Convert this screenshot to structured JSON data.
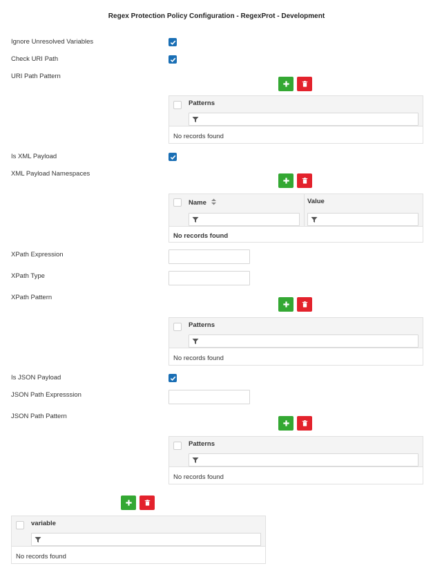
{
  "title": "Regex Protection Policy Configuration - RegexProt - Development",
  "fields": {
    "ignore_unresolved": "Ignore Unresolved Variables",
    "check_uri_path": "Check URI Path",
    "uri_path_pattern": "URI Path Pattern",
    "is_xml_payload": "Is XML Payload",
    "xml_payload_namespaces": "XML Payload Namespaces",
    "xpath_expression": "XPath Expression",
    "xpath_type": "XPath Type",
    "xpath_pattern": "XPath Pattern",
    "is_json_payload": "Is JSON Payload",
    "json_path_expression": "JSON Path Expresssion",
    "json_path_pattern": "JSON Path Pattern"
  },
  "checkboxes": {
    "ignore_unresolved": true,
    "check_uri_path": true,
    "is_xml_payload": true,
    "is_json_payload": true
  },
  "inputs": {
    "xpath_expression": "",
    "xpath_type": "",
    "json_path_expression": ""
  },
  "grids": {
    "uri_patterns": {
      "columns": [
        "Patterns"
      ],
      "empty": "No records found"
    },
    "xml_namespaces": {
      "columns": [
        "Name",
        "Value"
      ],
      "empty": "No records found"
    },
    "xpath_patterns": {
      "columns": [
        "Patterns"
      ],
      "empty": "No records found"
    },
    "json_patterns": {
      "columns": [
        "Patterns"
      ],
      "empty": "No records found"
    },
    "variables": {
      "columns": [
        "variable"
      ],
      "empty": "No records found"
    }
  },
  "icons": {
    "add": "plus-icon",
    "delete": "trash-icon",
    "filter": "filter-icon",
    "sort": "sort-icon",
    "check": "check-icon"
  },
  "colors": {
    "add_button": "#34a833",
    "delete_button": "#e3222c",
    "checkbox": "#1a6fb5",
    "header_bg": "#f4f4f4"
  }
}
